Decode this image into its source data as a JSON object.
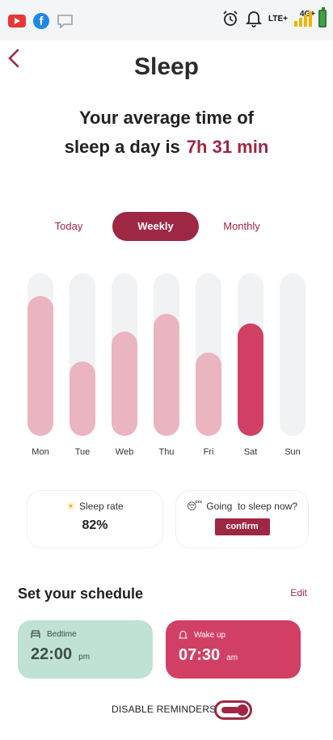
{
  "status_bar": {
    "network_top": "4G+",
    "network_label": "LTE+",
    "icons": [
      "youtube-icon",
      "facebook-icon",
      "message-icon",
      "alarm-icon",
      "bell-icon",
      "signal-icon",
      "battery-icon"
    ],
    "fb_glyph": "f"
  },
  "header": {
    "title": "Sleep"
  },
  "summary": {
    "line1": "Your average time of",
    "line2": "sleep a day is",
    "value": "7h 31 min"
  },
  "tabs": [
    {
      "label": "Today",
      "active": false
    },
    {
      "label": "Weekly",
      "active": true
    },
    {
      "label": "Monthly",
      "active": false
    }
  ],
  "chart_data": {
    "type": "bar",
    "categories": [
      "Mon",
      "Tue",
      "Web",
      "Thu",
      "Fri",
      "Sat",
      "Sun"
    ],
    "values": [
      0.86,
      0.46,
      0.64,
      0.75,
      0.51,
      0.69,
      0
    ],
    "highlight_index": 5,
    "colors": {
      "bar": "#eab5c1",
      "highlight": "#d23f65",
      "track": "#f1f2f4"
    }
  },
  "stats": {
    "sleep_rate": {
      "label": "Sleep rate",
      "value": "82%",
      "icon": "sun-icon",
      "icon_glyph": "☀"
    },
    "going_to_sleep": {
      "label": "Going  to sleep now?",
      "button": "confirm",
      "icon": "sleepy-face-icon",
      "icon_glyph": "😴"
    }
  },
  "schedule": {
    "title": "Set your schedule",
    "edit_label": "Edit",
    "bedtime": {
      "label": "Bedtime",
      "time": "22:00",
      "suffix": "pm",
      "icon": "bed-icon"
    },
    "wakeup": {
      "label": "Wake up",
      "time": "07:30",
      "suffix": "am",
      "icon": "bell-icon"
    }
  },
  "reminders": {
    "label": "DISABLE REMINDERS",
    "enabled": true
  },
  "colors": {
    "accent": "#9e2744",
    "highlight": "#d23f65",
    "mint": "#bfe2d4"
  }
}
